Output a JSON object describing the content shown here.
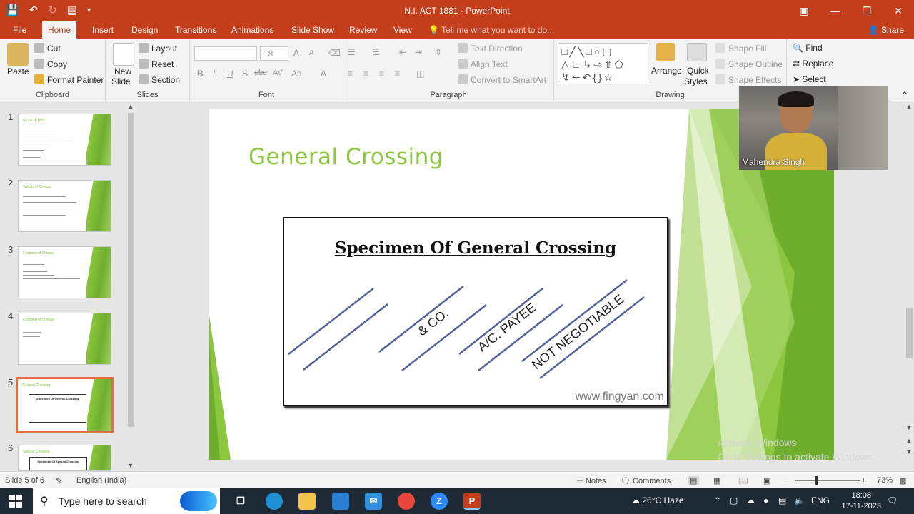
{
  "window": {
    "title": "N.I. ACT 1881 - PowerPoint",
    "qat_icons": [
      "save-icon",
      "undo-icon",
      "redo-icon",
      "present-from-start-icon",
      "customize-qat-icon"
    ]
  },
  "tabs": {
    "file": "File",
    "home": "Home",
    "insert": "Insert",
    "design": "Design",
    "transitions": "Transitions",
    "animations": "Animations",
    "slideshow": "Slide Show",
    "review": "Review",
    "view": "View",
    "tellme": "Tell me what you want to do...",
    "share": "Share"
  },
  "ribbon": {
    "clipboard": {
      "label": "Clipboard",
      "paste": "Paste",
      "cut": "Cut",
      "copy": "Copy",
      "format_painter": "Format Painter"
    },
    "slides": {
      "label": "Slides",
      "new_slide_1": "New",
      "new_slide_2": "Slide",
      "layout": "Layout",
      "reset": "Reset",
      "section": "Section"
    },
    "font": {
      "label": "Font",
      "font_name": "",
      "font_size": "18",
      "bold": "B",
      "italic": "I",
      "underline": "U",
      "shadow": "S",
      "strike": "abc",
      "spacing": "AV",
      "case": "Aa",
      "color": "A",
      "grow": "A",
      "shrink": "A"
    },
    "paragraph": {
      "label": "Paragraph",
      "text_direction": "Text Direction",
      "align_text": "Align Text",
      "smartart": "Convert to SmartArt"
    },
    "drawing": {
      "label": "Drawing",
      "arrange": "Arrange",
      "quick_styles_1": "Quick",
      "quick_styles_2": "Styles",
      "shape_fill": "Shape Fill",
      "shape_outline": "Shape Outline",
      "shape_effects": "Shape Effects"
    },
    "editing": {
      "find": "Find",
      "replace": "Replace",
      "select": "Select"
    }
  },
  "thumbnails": [
    {
      "num": "1",
      "title": "N.I. ACT 1881",
      "selected": false
    },
    {
      "num": "2",
      "title": "Validity of Cheque",
      "selected": false
    },
    {
      "num": "3",
      "title": "Features of Cheque",
      "selected": false
    },
    {
      "num": "4",
      "title": "Crossing of Cheque",
      "selected": false
    },
    {
      "num": "5",
      "title": "General Crossing",
      "selected": true
    },
    {
      "num": "6",
      "title": "Special Crossing",
      "selected": false
    }
  ],
  "thumb_box": {
    "slide5": "Specimen Of General Crossing",
    "slide6": "Specimen Of Special Crossing"
  },
  "slide": {
    "title": "General Crossing",
    "image_heading": "Specimen Of General Crossing",
    "phrase_co": "& CO.",
    "phrase_payee": "A/C. PAYEE",
    "phrase_neg": "NOT NEGOTIABLE",
    "watermark": "www.fingyan.com"
  },
  "webcam": {
    "name": "Mahendra Singh"
  },
  "activate_windows": {
    "line1": "Activate Windows",
    "line2": "Go to Settings to activate Windows."
  },
  "status": {
    "slide_info": "Slide 5 of 6",
    "language": "English (India)",
    "notes": "Notes",
    "comments": "Comments",
    "zoom": "73%"
  },
  "taskbar": {
    "search_placeholder": "Type here to search",
    "weather": "26°C  Haze",
    "lang": "ENG",
    "time": "18:08",
    "date": "17-11-2023"
  },
  "colors": {
    "accent": "#c43e1c",
    "slide_green": "#8cc63f",
    "selected_thumb_border": "#e4703f"
  }
}
